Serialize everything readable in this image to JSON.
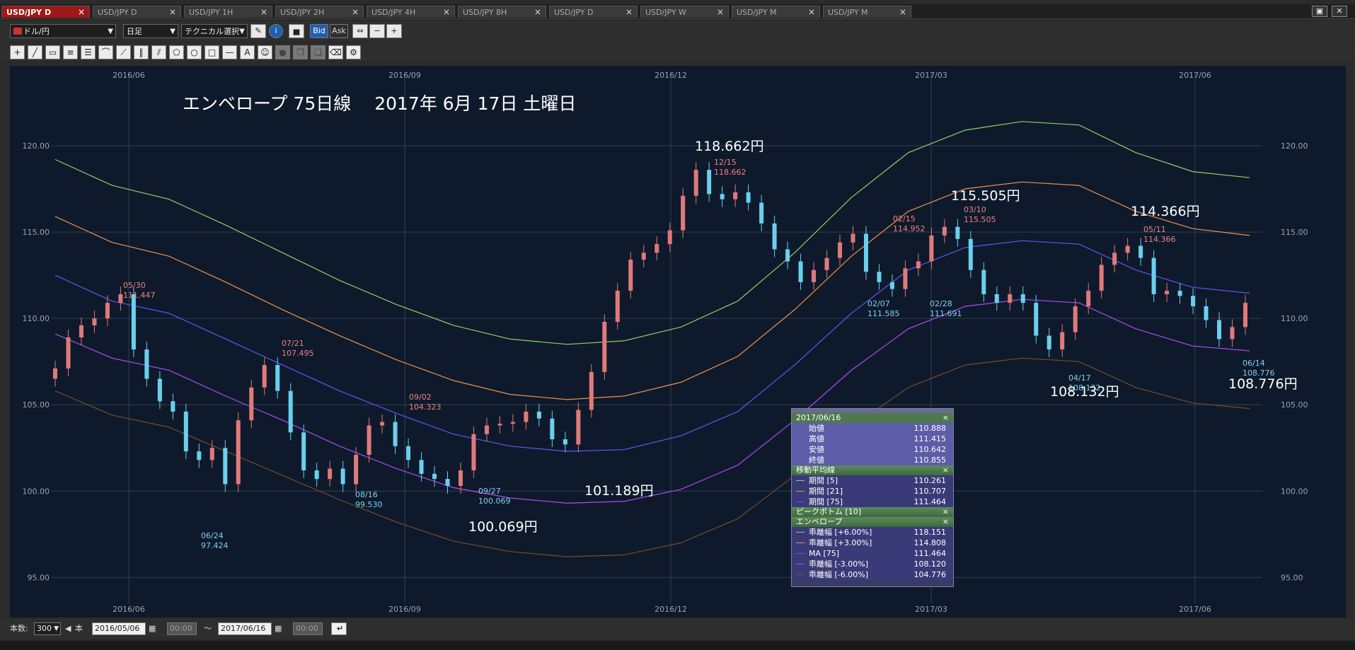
{
  "tabs": [
    {
      "label": "USD/JPY D",
      "active": true
    },
    {
      "label": "USD/JPY D",
      "active": false
    },
    {
      "label": "USD/JPY 1H",
      "active": false
    },
    {
      "label": "USD/JPY 2H",
      "active": false
    },
    {
      "label": "USD/JPY 4H",
      "active": false
    },
    {
      "label": "USD/JPY 8H",
      "active": false
    },
    {
      "label": "USD/JPY D",
      "active": false
    },
    {
      "label": "USD/JPY W",
      "active": false
    },
    {
      "label": "USD/JPY M",
      "active": false
    },
    {
      "label": "USD/JPY M",
      "active": false
    }
  ],
  "toolbar": {
    "symbol": "ドル/円",
    "timeframe": "日足",
    "technical": "テクニカル選択",
    "bid": "Bid",
    "ask": "Ask"
  },
  "chart_overlay_title": "エンベロープ 75日線　 2017年 6月 17日 土曜日",
  "chart_data": {
    "type": "candlestick",
    "ylim": [
      93.5,
      124.3
    ],
    "y_ticks": [
      "120.00",
      "115.00",
      "110.00",
      "105.00",
      "100.00",
      "95.00"
    ],
    "x_ticks": [
      "2016/06",
      "2016/09",
      "2016/12",
      "2017/03",
      "2017/06"
    ],
    "candles_daily_closes_sample": [
      107.1,
      108.9,
      109.6,
      110.0,
      110.9,
      111.4,
      108.2,
      106.5,
      105.2,
      104.6,
      102.3,
      101.8,
      102.5,
      100.4,
      104.1,
      106.0,
      107.3,
      105.8,
      103.4,
      101.2,
      100.7,
      101.3,
      100.4,
      102.1,
      103.8,
      104.0,
      102.6,
      101.8,
      101.0,
      100.7,
      100.3,
      101.2,
      103.3,
      103.8,
      103.9,
      104.0,
      104.6,
      104.2,
      103.0,
      102.7,
      104.7,
      106.9,
      109.8,
      111.6,
      113.4,
      113.8,
      114.3,
      115.1,
      117.1,
      118.6,
      117.2,
      116.9,
      117.3,
      116.7,
      115.5,
      114.0,
      113.3,
      112.1,
      112.8,
      113.5,
      114.4,
      114.9,
      112.7,
      112.1,
      111.7,
      112.9,
      113.3,
      114.8,
      115.3,
      114.6,
      112.8,
      111.4,
      110.9,
      111.4,
      110.9,
      109.0,
      108.2,
      109.2,
      110.7,
      111.6,
      113.1,
      113.8,
      114.2,
      113.5,
      111.4,
      111.6,
      111.3,
      110.7,
      109.9,
      108.8,
      109.5,
      110.9
    ],
    "series": [
      {
        "name": "乖離幅 [+6.00%]",
        "color": "#8fcf6a",
        "values": [
          119.2,
          117.7,
          116.9,
          115.4,
          113.8,
          112.2,
          110.8,
          109.6,
          108.8,
          108.5,
          108.7,
          109.5,
          111.0,
          113.8,
          117.0,
          119.6,
          120.9,
          121.4,
          121.2,
          119.6,
          118.5,
          118.15
        ]
      },
      {
        "name": "乖離幅 [+3.00%]",
        "color": "#f0904a",
        "values": [
          115.9,
          114.4,
          113.6,
          112.1,
          110.5,
          109.0,
          107.6,
          106.4,
          105.6,
          105.3,
          105.5,
          106.3,
          107.8,
          110.5,
          113.6,
          116.2,
          117.5,
          117.9,
          117.7,
          116.2,
          115.2,
          114.8
        ]
      },
      {
        "name": "MA [75]",
        "color": "#5a5af0",
        "values": [
          112.5,
          111.0,
          110.3,
          108.8,
          107.3,
          105.8,
          104.5,
          103.3,
          102.6,
          102.3,
          102.4,
          103.2,
          104.6,
          107.3,
          110.3,
          112.8,
          114.1,
          114.5,
          114.3,
          112.8,
          111.8,
          111.46
        ]
      },
      {
        "name": "乖離幅 [-3.00%]",
        "color": "#b04af0",
        "values": [
          109.1,
          107.7,
          107.0,
          105.5,
          104.1,
          102.6,
          101.3,
          100.2,
          99.6,
          99.3,
          99.4,
          100.1,
          101.5,
          104.1,
          107.0,
          109.4,
          110.7,
          111.1,
          110.9,
          109.4,
          108.4,
          108.12
        ]
      },
      {
        "name": "乖離幅 [-6.00%]",
        "color": "#7a4a2a",
        "values": [
          105.8,
          104.4,
          103.7,
          102.3,
          100.9,
          99.5,
          98.2,
          97.1,
          96.5,
          96.2,
          96.3,
          97.0,
          98.4,
          100.9,
          103.7,
          106.0,
          107.3,
          107.7,
          107.5,
          106.0,
          105.1,
          104.78
        ]
      }
    ],
    "short_ma": [
      {
        "name": "期間 [5]",
        "color": "#7fd07f"
      },
      {
        "name": "期間 [21]",
        "color": "#f0904a"
      },
      {
        "name": "期間 [75]",
        "color": "#5a5af0"
      }
    ],
    "annotations": [
      {
        "date": "05/30",
        "value": "111.447",
        "kind": "high"
      },
      {
        "date": "06/24",
        "value": "97.424",
        "kind": "low"
      },
      {
        "date": "07/21",
        "value": "107.495",
        "kind": "high"
      },
      {
        "date": "08/16",
        "value": "99.530",
        "kind": "low"
      },
      {
        "date": "09/02",
        "value": "104.323",
        "kind": "high"
      },
      {
        "date": "09/27",
        "value": "100.069",
        "kind": "low"
      },
      {
        "date": "12/15",
        "value": "118.662",
        "kind": "high"
      },
      {
        "date": "02/07",
        "value": "111.585",
        "kind": "low"
      },
      {
        "date": "02/15",
        "value": "114.952",
        "kind": "high"
      },
      {
        "date": "02/28",
        "value": "111.691",
        "kind": "low"
      },
      {
        "date": "03/10",
        "value": "115.505",
        "kind": "high"
      },
      {
        "date": "04/17",
        "value": "108.132",
        "kind": "low"
      },
      {
        "date": "05/11",
        "value": "114.366",
        "kind": "high"
      },
      {
        "date": "06/14",
        "value": "108.776",
        "kind": "low"
      }
    ],
    "big_labels": [
      "118.662円",
      "115.505円",
      "114.366円",
      "108.132円",
      "108.776円",
      "100.069円",
      "101.189円"
    ]
  },
  "legend": {
    "date": "2017/06/16",
    "ohlc": [
      {
        "label": "始値",
        "value": "110.888"
      },
      {
        "label": "高値",
        "value": "111.415"
      },
      {
        "label": "安値",
        "value": "110.642"
      },
      {
        "label": "終値",
        "value": "110.855"
      }
    ],
    "ma_title": "移動平均線",
    "ma": [
      {
        "label": "期間 [5]",
        "value": "110.261"
      },
      {
        "label": "期間 [21]",
        "value": "110.707"
      },
      {
        "label": "期間 [75]",
        "value": "111.464"
      }
    ],
    "peak_title": "ピークボトム [10]",
    "env_title": "エンベロープ",
    "env": [
      {
        "label": "乖離幅 [+6.00%]",
        "value": "118.151"
      },
      {
        "label": "乖離幅 [+3.00%]",
        "value": "114.808"
      },
      {
        "label": "MA [75]",
        "value": "111.464"
      },
      {
        "label": "乖離幅 [-3.00%]",
        "value": "108.120"
      },
      {
        "label": "乖離幅 [-6.00%]",
        "value": "104.776"
      }
    ]
  },
  "bottom": {
    "count_label": "本数:",
    "count": "300",
    "unit": "本",
    "from_date": "2016/05/06",
    "from_time": "00:00",
    "tilde": "〜",
    "to_date": "2017/06/16",
    "to_time": "00:00"
  }
}
